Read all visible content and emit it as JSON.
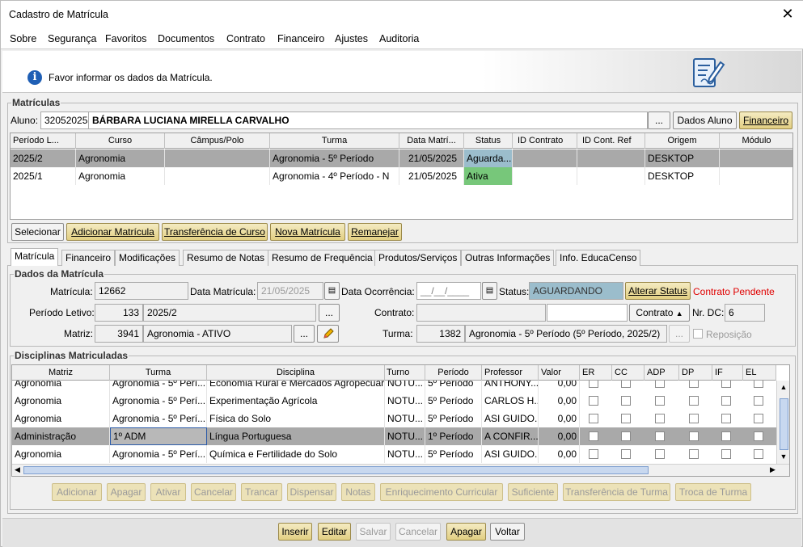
{
  "window": {
    "title": "Cadastro de Matrícula",
    "close": "✕"
  },
  "menu": [
    "Sobre",
    "Segurança",
    "Favoritos",
    "Documentos",
    "Contrato",
    "Financeiro",
    "Ajustes",
    "Auditoria"
  ],
  "info": {
    "icon": "info-icon",
    "text": "Favor informar os dados da Matrícula."
  },
  "matriculas": {
    "title": "Matrículas",
    "aluno_label": "Aluno:",
    "aluno_id": "32052025",
    "aluno_nome": "BÁRBARA LUCIANA MIRELLA CARVALHO",
    "ellipsis": "...",
    "dados_aluno": "Dados Aluno",
    "financeiro": "Financeiro",
    "columns": [
      "Período L...",
      "Curso",
      "Câmpus/Polo",
      "Turma",
      "Data Matrí...",
      "Status",
      "ID Contrato",
      "ID Cont. Ref",
      "Origem",
      "Módulo"
    ],
    "rows": [
      {
        "periodo": "2025/2",
        "curso": "Agronomia",
        "campus": "",
        "turma": "Agronomia - 5º Período",
        "data": "21/05/2025",
        "status": "Aguarda...",
        "id_contrato": "",
        "id_ref": "",
        "origem": "DESKTOP",
        "modulo": ""
      },
      {
        "periodo": "2025/1",
        "curso": "Agronomia",
        "campus": "",
        "turma": "Agronomia - 4º Período - N",
        "data": "21/05/2025",
        "status": "Ativa",
        "id_contrato": "",
        "id_ref": "",
        "origem": "DESKTOP",
        "modulo": ""
      }
    ],
    "buttons": {
      "selecionar": "Selecionar",
      "adicionar": "Adicionar Matrícula",
      "transferencia": "Transferência de Curso",
      "nova": "Nova Matrícula",
      "remanejar": "Remanejar"
    }
  },
  "tabs": [
    "Matrícula",
    "Financeiro",
    "Modificações",
    "Resumo de Notas",
    "Resumo de Frequência",
    "Produtos/Serviços",
    "Outras Informações",
    "Info. EducaCenso"
  ],
  "dados": {
    "title": "Dados da Matrícula",
    "matricula_label": "Matrícula:",
    "matricula": "12662",
    "data_mat_label": "Data Matrícula:",
    "data_mat": "21/05/2025",
    "data_oc_label": "Data Ocorrência:",
    "data_oc": "__/__/____",
    "status_label": "Status:",
    "status": "AGUARDANDO",
    "alterar_status": "Alterar Status",
    "contrato_pendente": "Contrato Pendente",
    "periodo_label": "Período Letivo:",
    "periodo_id": "133",
    "periodo": "2025/2",
    "contrato_label": "Contrato:",
    "contrato": "",
    "contrato_btn": "Contrato",
    "nrdc_label": "Nr. DC:",
    "nrdc": "6",
    "matriz_label": "Matriz:",
    "matriz_id": "3941",
    "matriz": "Agronomia - ATIVO",
    "turma_label": "Turma:",
    "turma_id": "1382",
    "turma": "Agronomia - 5º Período (5º Período, 2025/2)",
    "reposicao": "Reposição"
  },
  "disciplinas": {
    "title": "Disciplinas Matriculadas",
    "columns": [
      "Matriz",
      "Turma",
      "Disciplina",
      "Turno",
      "Período",
      "Professor",
      "Valor",
      "ER",
      "CC",
      "ADP",
      "DP",
      "IF",
      "EL"
    ],
    "rows": [
      {
        "matriz": "Agronomia",
        "turma": "Agronomia - 5º Perí...",
        "disciplina": "Economia Rural e Mercados Agropecuários",
        "turno": "NOTU...",
        "periodo": "5º Período",
        "professor": "ANTHONY...",
        "valor": "0,00"
      },
      {
        "matriz": "Agronomia",
        "turma": "Agronomia - 5º Perí...",
        "disciplina": "Experimentação Agrícola",
        "turno": "NOTU...",
        "periodo": "5º Período",
        "professor": "CARLOS H...",
        "valor": "0,00"
      },
      {
        "matriz": "Agronomia",
        "turma": "Agronomia - 5º Perí...",
        "disciplina": "Física do Solo",
        "turno": "NOTU...",
        "periodo": "5º Período",
        "professor": "ASI GUIDO...",
        "valor": "0,00"
      },
      {
        "matriz": "Administração",
        "turma": "1º ADM",
        "disciplina": "Língua Portuguesa",
        "turno": "NOTU...",
        "periodo": "1º Período",
        "professor": "A CONFIR...",
        "valor": "0,00"
      },
      {
        "matriz": "Agronomia",
        "turma": "Agronomia - 5º Perí...",
        "disciplina": "Química e Fertilidade do Solo",
        "turno": "NOTU...",
        "periodo": "5º Período",
        "professor": "ASI GUIDO...",
        "valor": "0,00"
      }
    ],
    "buttons": [
      "Adicionar",
      "Apagar",
      "Ativar",
      "Cancelar",
      "Trancar",
      "Dispensar",
      "Notas",
      "Enriquecimento Curricular",
      "Suficiente",
      "Transferência de Turma",
      "Troca de Turma"
    ]
  },
  "footer": [
    "Inserir",
    "Editar",
    "Salvar",
    "Cancelar",
    "Apagar",
    "Voltar"
  ],
  "colors": {
    "selected_row": "#a9a9a9",
    "status_aguardando": "#9bbdcc",
    "status_ativa": "#77c77a",
    "pending_red": "#e00000",
    "button_yellow": "#e8d890"
  }
}
